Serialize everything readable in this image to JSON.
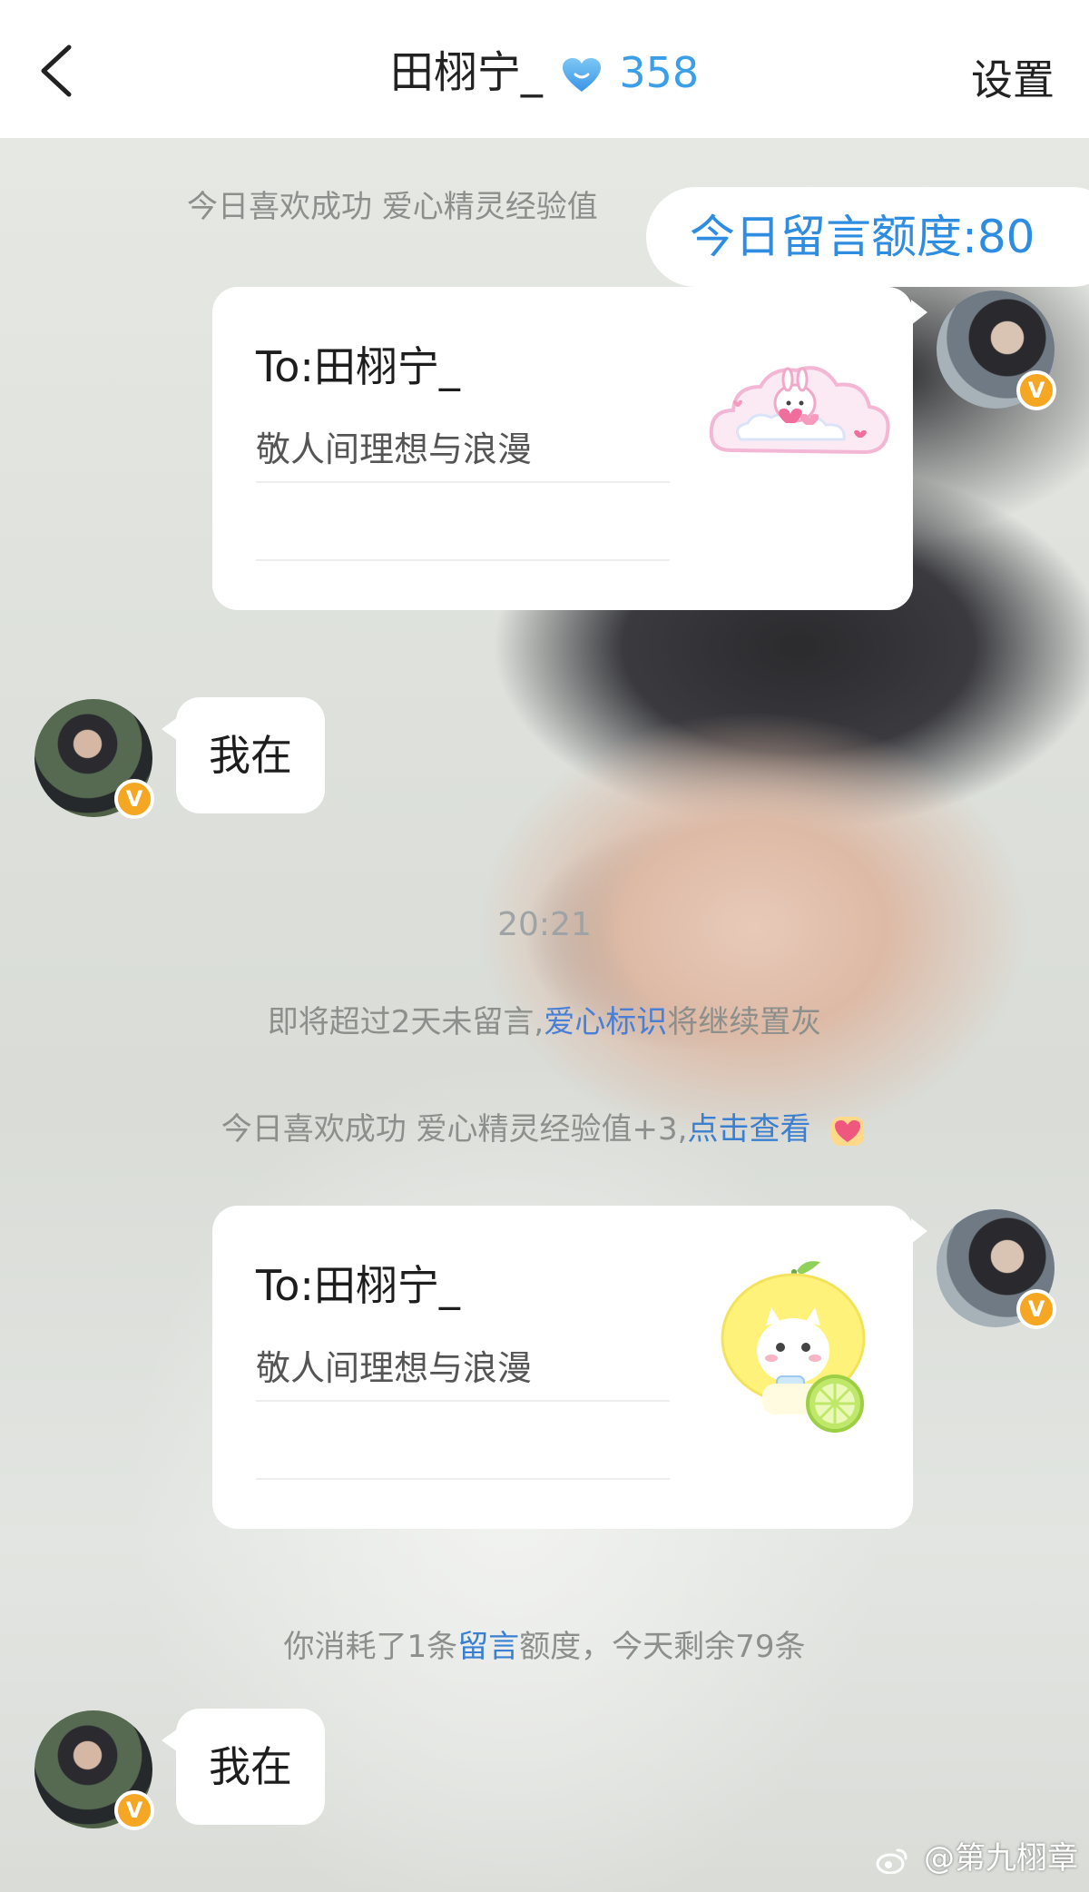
{
  "header": {
    "title": "田栩宁_",
    "heart_count": "358",
    "settings_label": "设置",
    "heart_color": "#3a9fe8"
  },
  "system": {
    "liked_prefix": "今日喜欢成功 爱心精灵经验值",
    "liked_full_prefix": "今日喜欢成功 爱心精灵经验值+3,",
    "liked_link": "点击查看",
    "time": "20:21",
    "warning_prefix": "即将超过2天未留言,",
    "warning_highlight": "爱心标识",
    "warning_suffix": "将继续置灰",
    "consumed_prefix": "你消耗了1条",
    "consumed_link": "留言",
    "consumed_suffix": "额度，今天剩余79条"
  },
  "quota_label": "今日留言额度:80",
  "messages": [
    {
      "to": "To:田栩宁_",
      "text": "敬人间理想与浪漫",
      "sticker": "cloud-bunny-sticker"
    },
    {
      "reply": "我在"
    },
    {
      "to": "To:田栩宁_",
      "text": "敬人间理想与浪漫",
      "sticker": "lemon-cat-sticker"
    },
    {
      "reply": "我在"
    }
  ],
  "verified_badge": "V",
  "watermark": "@第九栩章",
  "colors": {
    "accent_blue": "#2e8de0",
    "badge_orange": "#f5a623"
  }
}
